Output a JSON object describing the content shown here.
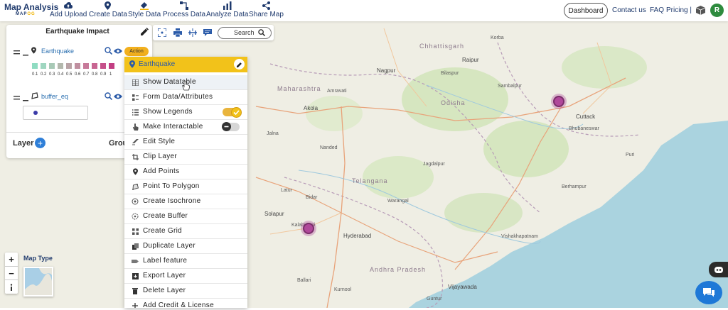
{
  "topbar": {
    "brand_title": "Map Analysis",
    "brand_sub_left": "MAP",
    "brand_sub_right": "OG",
    "nav": [
      {
        "label": "Add Upload",
        "icon": "cloud-upload-icon"
      },
      {
        "label": "Create Data",
        "icon": "map-pin-icon"
      },
      {
        "label": "Style Data",
        "icon": "paint-bucket-icon"
      },
      {
        "label": "Process Data",
        "icon": "process-nodes-icon"
      },
      {
        "label": "Analyze Data",
        "icon": "analyze-icon"
      },
      {
        "label": "Share Map",
        "icon": "share-icon"
      }
    ],
    "dashboard": "Dashboard",
    "contact": "Contact us",
    "faq": "FAQ",
    "pricing": "Pricing |",
    "avatar_initial": "R"
  },
  "layer_panel": {
    "title": "Earthquake Impact",
    "layers": [
      {
        "name": "Earthquake"
      },
      {
        "name": "buffer_eq"
      }
    ],
    "legend_values": [
      "0.1",
      "0.2",
      "0.3",
      "0.4",
      "0.5",
      "0.6",
      "0.7",
      "0.8",
      "0.9",
      "1"
    ],
    "legend_colors": [
      "#8fdcc2",
      "#9fd6c0",
      "#a8c9b6",
      "#b3b8ad",
      "#b9a3a6",
      "#c08fa0",
      "#c77a9a",
      "#c86592",
      "#c5508a",
      "#c23e83"
    ],
    "buffer_dot_color": "#3b3ba8",
    "footer_layer": "Layer",
    "footer_group": "Grou"
  },
  "toolbar": {
    "search_label": "Search"
  },
  "action_menu": {
    "badge": "Action",
    "header": "Earthquake",
    "items": [
      {
        "label": "Show Datatable",
        "icon": "table-icon"
      },
      {
        "label": "Form Data/Attributes",
        "icon": "form-icon"
      },
      {
        "label": "Show Legends",
        "icon": "list-icon",
        "toggle": "on"
      },
      {
        "label": "Make Interactable",
        "icon": "hand-pointer-icon",
        "toggle": "off"
      },
      {
        "label": "Edit Style",
        "icon": "brush-icon"
      },
      {
        "label": "Clip Layer",
        "icon": "crop-icon"
      },
      {
        "label": "Add Points",
        "icon": "map-pin-icon"
      },
      {
        "label": "Point To Polygon",
        "icon": "polygon-icon"
      },
      {
        "label": "Create Isochrone",
        "icon": "isochrone-icon"
      },
      {
        "label": "Create Buffer",
        "icon": "buffer-icon"
      },
      {
        "label": "Create Grid",
        "icon": "grid-icon"
      },
      {
        "label": "Duplicate Layer",
        "icon": "duplicate-icon"
      },
      {
        "label": "Label feature",
        "icon": "label-icon"
      },
      {
        "label": "Export Layer",
        "icon": "export-icon"
      },
      {
        "label": "Delete Layer",
        "icon": "trash-icon"
      },
      {
        "label": "Add Credit & License",
        "icon": "plus-icon"
      }
    ]
  },
  "map": {
    "map_type_label": "Map Type",
    "zoom_in": "+",
    "zoom_out": "−",
    "colors": {
      "land": "#efeee4",
      "water": "#aad3df",
      "forest": "#cfe3b7",
      "marker": "#b0489a"
    },
    "places": [
      "Akola",
      "Nagpur",
      "Solapur",
      "Hyderabad",
      "Cuttack",
      "Bhubaneswar",
      "Odisha",
      "Kalaburagi",
      "Warangal",
      "Nanded",
      "Raipur",
      "Amravati",
      "Jalna",
      "Latur",
      "Vijayawada",
      "Guntur",
      "Kurnool",
      "Puri",
      "Berhampur",
      "Sambalpur",
      "Telangana",
      "Chhattisgarh",
      "Maharashtra",
      "Andhra Pradesh",
      "Vishakhapatnam",
      "Ballari",
      "Bidar",
      "Jagdalpur",
      "Korba",
      "Bilaspur"
    ]
  }
}
